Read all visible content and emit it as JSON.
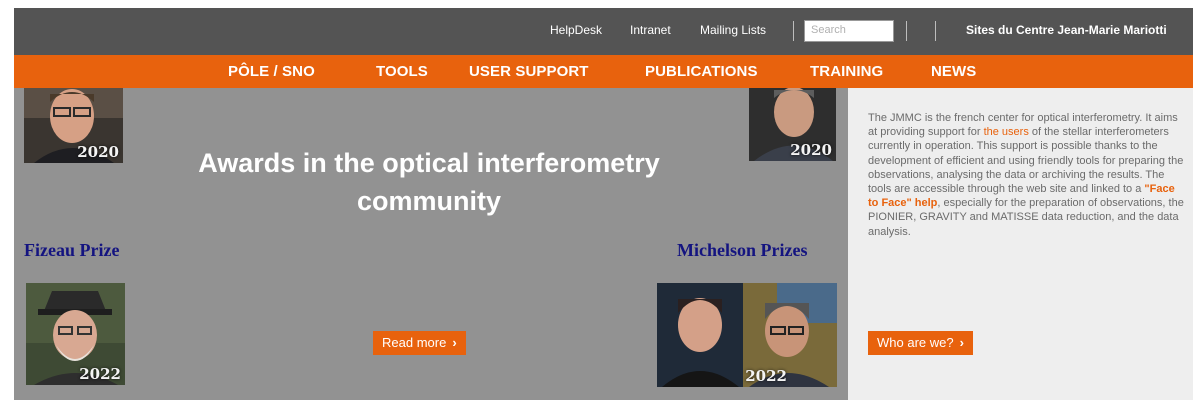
{
  "topbar": {
    "links": [
      "HelpDesk",
      "Intranet",
      "Mailing Lists"
    ],
    "search_placeholder": "Search",
    "sites_label": "Sites du Centre Jean-Marie Mariotti"
  },
  "nav": {
    "items": [
      "PÔLE / SNO",
      "TOOLS",
      "USER SUPPORT",
      "PUBLICATIONS",
      "TRAINING",
      "NEWS"
    ]
  },
  "hero": {
    "title_line1": "Awards in the optical interferometry",
    "title_line2": "community",
    "fizeau_label": "Fizeau Prize",
    "michelson_label": "Michelson  Prizes",
    "read_more": "Read more",
    "photos": {
      "fizeau_2020_year": "2020",
      "fizeau_2022_year": "2022",
      "michelson_2020_year": "2020",
      "michelson_2022_year": "2022"
    }
  },
  "aside": {
    "text_1": "The JMMC is the french center for optical interferometry. It aims at providing support for ",
    "link_users": "the users",
    "text_2": " of the stellar interferometers currently in operation. This support is possible thanks to the development of efficient and using friendly tools for preparing the observations, analysing the data or archiving the results. The tools are accessible through the web site and linked to a ",
    "link_face": "\"Face to Face\" help",
    "text_3": ", especially for the preparation of observations, the PIONIER, GRAVITY and MATISSE data reduction, and the data analysis.",
    "who_button": "Who are we?"
  },
  "colors": {
    "accent_orange": "#e8620d",
    "topbar_bg": "#545454",
    "hero_bg": "#929292",
    "aside_bg": "#eeeeee",
    "prize_text": "#141480"
  }
}
